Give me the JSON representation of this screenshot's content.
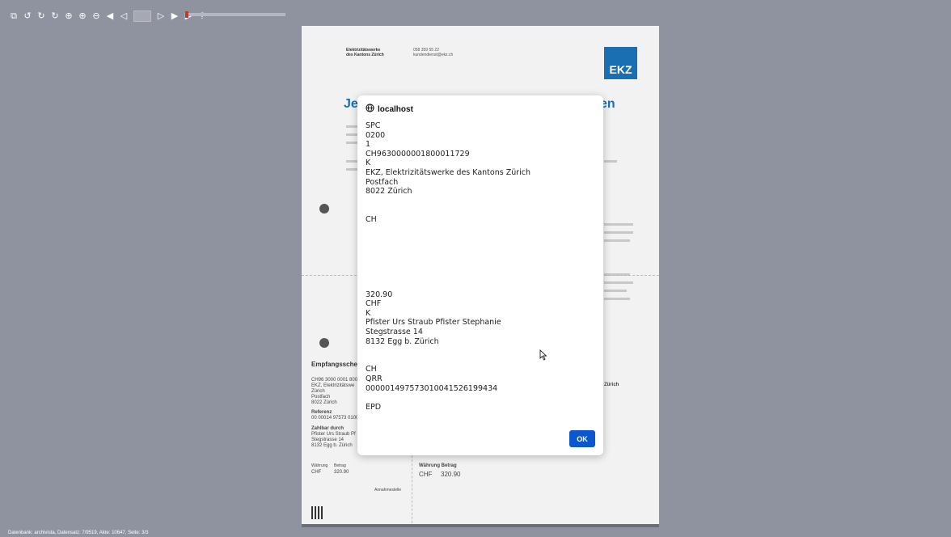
{
  "toolbar": {
    "icons": [
      "copy-icon",
      "undo-icon",
      "redo-icon",
      "refresh-icon",
      "zoom-fit-icon",
      "zoom-in-icon",
      "zoom-out-icon",
      "first-page-icon",
      "prev-page-icon",
      "next-page-icon",
      "last-page-icon",
      "play-icon",
      "help-icon"
    ],
    "glyphs": {
      "copy": "⧉",
      "undo": "↺",
      "redo": "↻",
      "refresh": "↻",
      "zoom_fit": "⊕",
      "zoom_in": "⊕",
      "zoom_out": "⊖",
      "first": "◀",
      "prev": "◁",
      "next": "▷",
      "last": "▶",
      "next2": "▶",
      "help": "?"
    },
    "progress_fraction": 0.03
  },
  "document": {
    "company_line1": "Elektrizitätswerke",
    "company_line2": "des Kantons Zürich",
    "phone": "058 359 55 22",
    "email": "kundendienst@ekz.ch",
    "logo_text": "EKZ",
    "title_left": "Je",
    "title_right": "en",
    "receipt_title": "Empfangsschein",
    "receipt_account": "CH96 3000 0001 8000 1172 9",
    "receipt_creditor1": "EKZ, Elektrizitätswe",
    "receipt_city1": "Zürich",
    "receipt_postfach": "Postfach",
    "receipt_city2": "8022 Zürich",
    "receipt_reference_label": "Referenz",
    "receipt_reference": "00 00014 97573 0100",
    "receipt_payer_label": "Zahlbar durch",
    "receipt_payer1": "Pfister Urs Straub Pf",
    "receipt_payer2": "Stegstrasse 14",
    "receipt_payer3": "8132 Egg b. Zürich",
    "currency_label": "Währung",
    "amount_label": "Betrag",
    "currency": "CHF",
    "amount": "320.90",
    "acceptance": "Annahmestelle",
    "right_currency_amount_label": "Währung Betrag",
    "right_currency": "CHF",
    "right_amount": "320.90",
    "right_zurich": "Zürich"
  },
  "dialog": {
    "host": "localhost",
    "message": "SPC\n0200\n1\nCH9630000001800011729\nK\nEKZ, Elektrizitätswerke des Kantons Zürich\nPostfach\n8022 Zürich\n\n\nCH\n\n\n\n\n\n\n\n320.90\nCHF\nK\nPfister Urs Straub Pfister Stephanie\nStegstrasse 14\n8132 Egg b. Zürich\n\n\nCH\nQRR\n000001497573010041526199434\n\nEPD",
    "ok_label": "OK"
  },
  "statusbar": {
    "text": "Datenbank: archivista, Datensatz: 7/9519, Akte: 10647, Seite: 3/3"
  },
  "colors": {
    "background": "#8f93a0",
    "ekz_blue": "#1a6fb3",
    "ok_button": "#0b57d0"
  }
}
